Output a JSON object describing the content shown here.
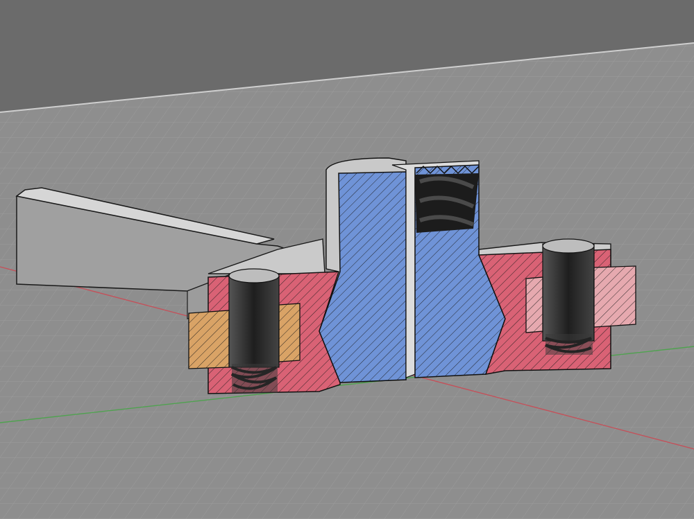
{
  "viewport": {
    "kind": "3d-cad-section-view",
    "background_top": "#6b6b6b",
    "ground_plane": "#8e8e8e",
    "grid_line": "#a6a6a6",
    "x_axis_color": "#c4515a",
    "z_axis_color": "#4fa24f"
  },
  "section_colors": {
    "body_fill": "#6f93d7",
    "clamp_fill": "#d96275",
    "insert_left_fill": "#d9a366",
    "insert_right_fill": "#e6a9af",
    "solid_face": "#d5d5d5",
    "solid_side": "#a0a0a0",
    "bore_dark": "#2c2c2c"
  },
  "parts": [
    {
      "name": "lever-arm"
    },
    {
      "name": "center-body-left"
    },
    {
      "name": "center-body-right"
    },
    {
      "name": "left-clamp-block"
    },
    {
      "name": "right-clamp-block"
    },
    {
      "name": "left-insert"
    },
    {
      "name": "right-insert"
    },
    {
      "name": "left-screw-hole"
    },
    {
      "name": "right-screw-hole"
    },
    {
      "name": "threaded-bore"
    }
  ]
}
